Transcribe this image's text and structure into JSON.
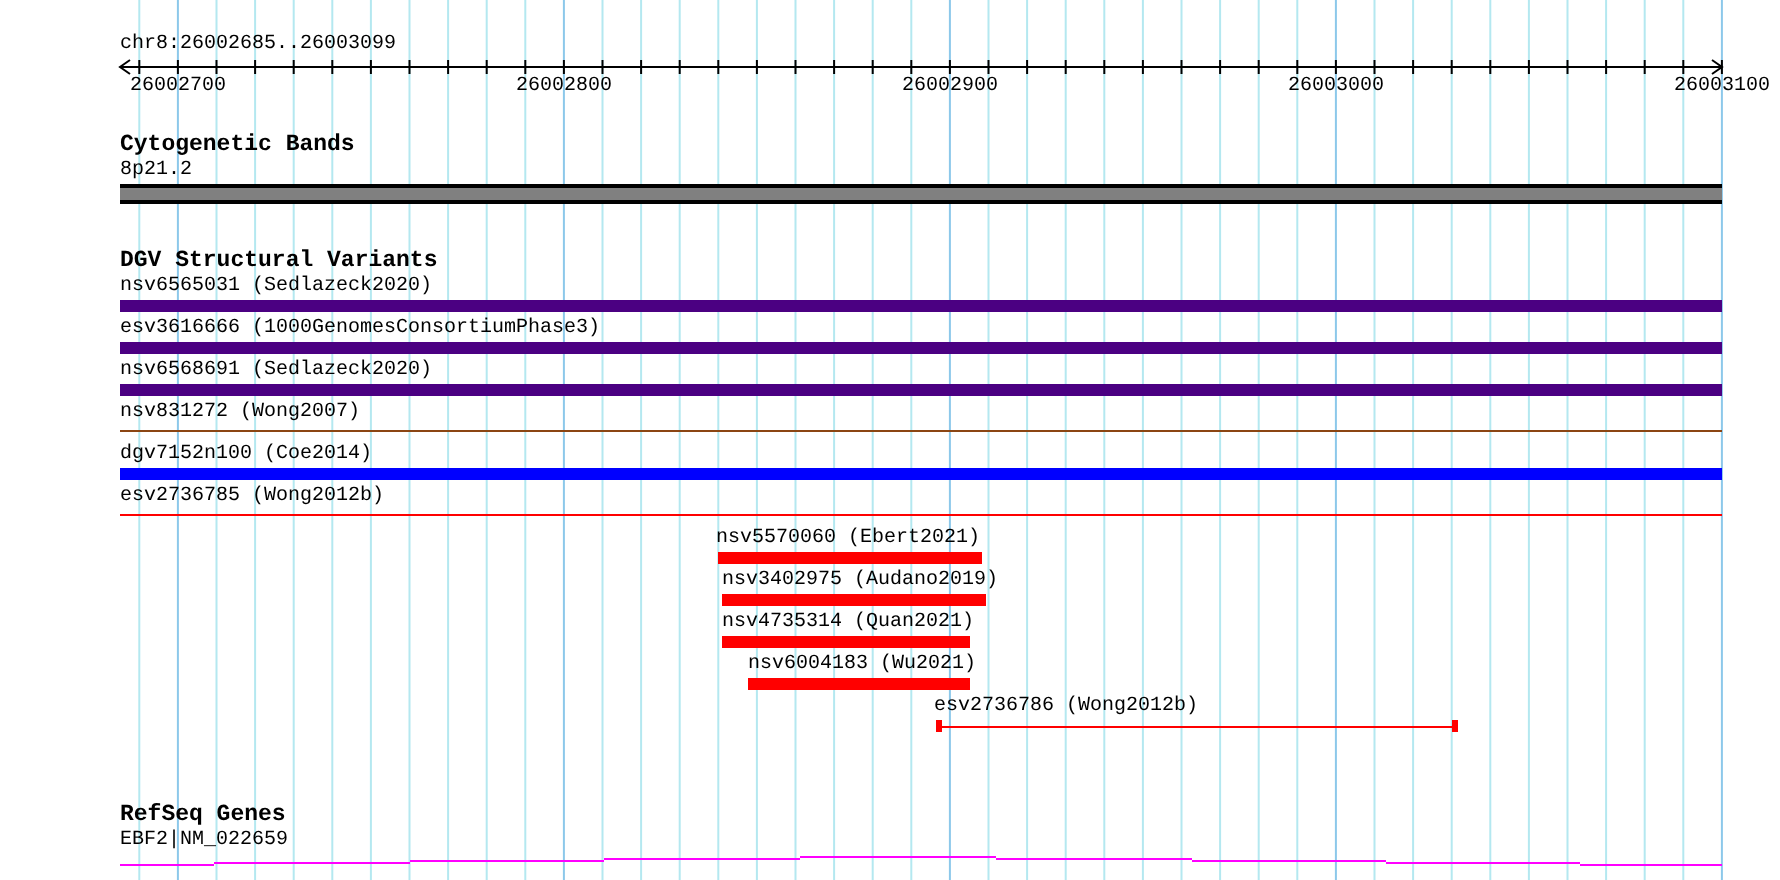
{
  "ruler": {
    "location": "chr8:26002685..26003099",
    "ticks": [
      "26002700",
      "26002800",
      "26002900",
      "26003000",
      "26003100"
    ]
  },
  "tracks": [
    {
      "title": "Cytogenetic Bands",
      "features": [
        {
          "label": "8p21.2",
          "kind": "band",
          "color": "#808080"
        }
      ]
    },
    {
      "title": "DGV Structural Variants",
      "features": [
        {
          "label": "nsv6565031 (Sedlazeck2020)",
          "kind": "bar",
          "color": "#4b0082"
        },
        {
          "label": "esv3616666 (1000GenomesConsortiumPhase3)",
          "kind": "bar",
          "color": "#4b0082"
        },
        {
          "label": "nsv6568691 (Sedlazeck2020)",
          "kind": "bar",
          "color": "#4b0082"
        },
        {
          "label": "nsv831272 (Wong2007)",
          "kind": "line",
          "color": "#8b4513"
        },
        {
          "label": "dgv7152n100 (Coe2014)",
          "kind": "bar",
          "color": "#0000ff"
        },
        {
          "label": "esv2736785 (Wong2012b)",
          "kind": "line",
          "color": "#ff0000"
        },
        {
          "label": "nsv5570060 (Ebert2021)",
          "kind": "bar",
          "color": "#ff0000"
        },
        {
          "label": "nsv3402975 (Audano2019)",
          "kind": "bar",
          "color": "#ff0000"
        },
        {
          "label": "nsv4735314 (Quan2021)",
          "kind": "bar",
          "color": "#ff0000"
        },
        {
          "label": "nsv6004183 (Wu2021)",
          "kind": "bar",
          "color": "#ff0000"
        },
        {
          "label": "esv2736786 (Wong2012b)",
          "kind": "span",
          "color": "#ff0000"
        }
      ]
    },
    {
      "title": "RefSeq Genes",
      "features": [
        {
          "label": "EBF2|NM_022659",
          "kind": "gene",
          "color": "#ff00ff"
        }
      ]
    }
  ]
}
